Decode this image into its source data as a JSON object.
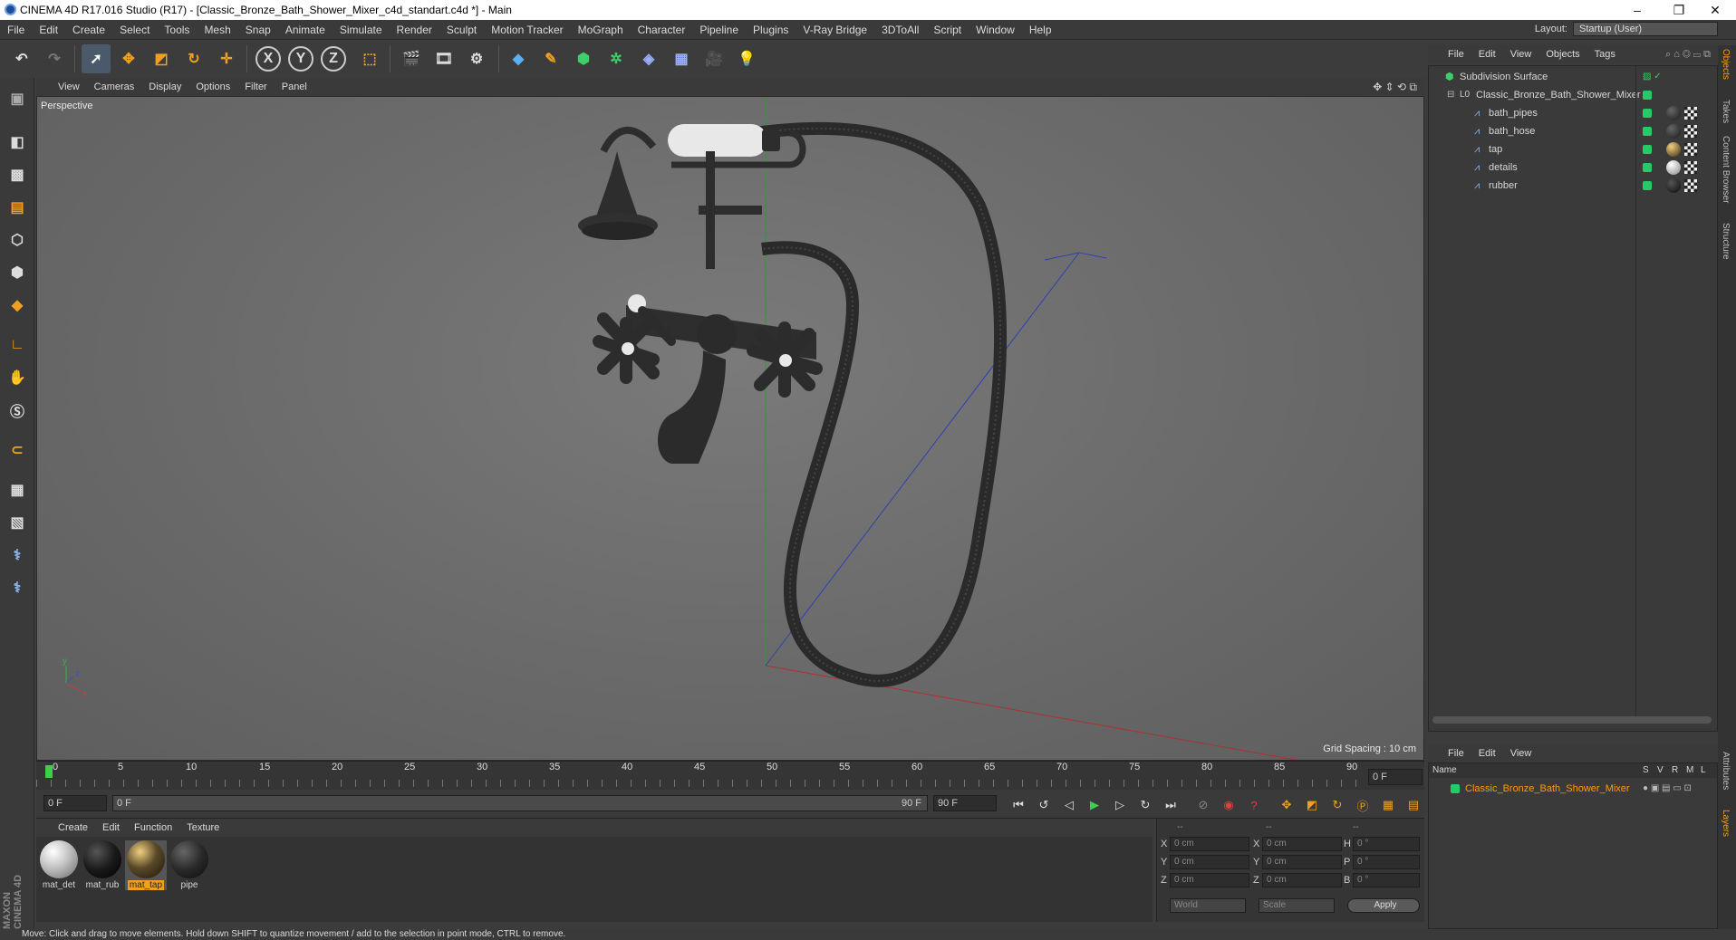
{
  "window": {
    "title": "CINEMA 4D R17.016 Studio (R17) - [Classic_Bronze_Bath_Shower_Mixer_c4d_standart.c4d *] - Main",
    "minimize": "–",
    "restore": "❐",
    "close": "✕"
  },
  "menubar": {
    "items": [
      "File",
      "Edit",
      "Create",
      "Select",
      "Tools",
      "Mesh",
      "Snap",
      "Animate",
      "Simulate",
      "Render",
      "Sculpt",
      "Motion Tracker",
      "MoGraph",
      "Character",
      "Pipeline",
      "Plugins",
      "V-Ray Bridge",
      "3DToAll",
      "Script",
      "Window",
      "Help"
    ],
    "layout_label": "Layout:",
    "layout_value": "Startup (User)"
  },
  "toolbar": {
    "axis_x": "X",
    "axis_y": "Y",
    "axis_z": "Z"
  },
  "viewport": {
    "menu": [
      "View",
      "Cameras",
      "Display",
      "Options",
      "Filter",
      "Panel"
    ],
    "camera_label": "Perspective",
    "grid_spacing": "Grid Spacing : 10 cm",
    "axis_y": "y",
    "axis_x": "x",
    "axis_z": "z"
  },
  "timeline": {
    "ticks": [
      "0",
      "5",
      "10",
      "15",
      "20",
      "25",
      "30",
      "35",
      "40",
      "45",
      "50",
      "55",
      "60",
      "65",
      "70",
      "75",
      "80",
      "85",
      "90"
    ],
    "current_frame_right": "0 F",
    "start_field": "0 F",
    "range_start": "0 F",
    "range_end": "90 F",
    "end_field": "90 F"
  },
  "material_manager": {
    "menu": [
      "Create",
      "Edit",
      "Function",
      "Texture"
    ],
    "materials": [
      {
        "name": "mat_det",
        "color": "#c8c8c8",
        "selected": false
      },
      {
        "name": "mat_rub",
        "color": "#1a1a1a",
        "selected": false
      },
      {
        "name": "mat_tap",
        "color": "#5a4a2a",
        "selected": true
      },
      {
        "name": "pipe",
        "color": "#2a2a2a",
        "selected": false
      }
    ]
  },
  "coordinates": {
    "header": [
      "--",
      "--",
      "--"
    ],
    "rows": [
      {
        "a": "X",
        "av": "0 cm",
        "b": "X",
        "bv": "0 cm",
        "c": "H",
        "cv": "0 °"
      },
      {
        "a": "Y",
        "av": "0 cm",
        "b": "Y",
        "bv": "0 cm",
        "c": "P",
        "cv": "0 °"
      },
      {
        "a": "Z",
        "av": "0 cm",
        "b": "Z",
        "bv": "0 cm",
        "c": "B",
        "cv": "0 °"
      }
    ],
    "space": "World",
    "mode": "Scale",
    "apply": "Apply"
  },
  "object_manager": {
    "menu": [
      "File",
      "Edit",
      "View",
      "Objects",
      "Tags"
    ],
    "objects": [
      {
        "name": "Subdivision Surface",
        "indent": 0
      },
      {
        "name": "Classic_Bronze_Bath_Shower_Mixer",
        "indent": 1
      },
      {
        "name": "bath_pipes",
        "indent": 2
      },
      {
        "name": "bath_hose",
        "indent": 2
      },
      {
        "name": "tap",
        "indent": 2
      },
      {
        "name": "details",
        "indent": 2
      },
      {
        "name": "rubber",
        "indent": 2
      }
    ],
    "accent": "#22cc66"
  },
  "layer_manager": {
    "menu": [
      "File",
      "Edit",
      "View"
    ],
    "columns": [
      "Name",
      "S",
      "V",
      "R",
      "M",
      "L"
    ],
    "layers": [
      {
        "name": "Classic_Bronze_Bath_Shower_Mixer",
        "color": "#ff9a00"
      }
    ]
  },
  "right_tabs": [
    "Objects",
    "Takes",
    "Content Browser",
    "Structure",
    "Attributes",
    "Layers"
  ],
  "status": {
    "text": "Move: Click and drag to move elements. Hold down SHIFT to quantize movement / add to the selection in point mode, CTRL to remove."
  },
  "brand": "MAXON CINEMA 4D"
}
